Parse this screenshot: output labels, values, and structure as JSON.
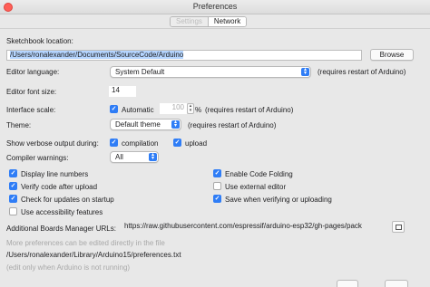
{
  "window": {
    "title": "Preferences"
  },
  "tabs": [
    {
      "label": "Settings",
      "active": false
    },
    {
      "label": "Network",
      "active": true
    }
  ],
  "sketchbook": {
    "label": "Sketchbook location:",
    "path": "/Users/ronalexander/Documents/SourceCode/Arduino",
    "browse_label": "Browse"
  },
  "editor_language": {
    "label": "Editor language:",
    "value": "System Default",
    "note": "(requires restart of Arduino)"
  },
  "editor_font_size": {
    "label": "Editor font size:",
    "value": "14"
  },
  "interface_scale": {
    "label": "Interface scale:",
    "automatic_label": "Automatic",
    "automatic_checked": true,
    "value": "100",
    "unit": "%",
    "note": "(requires restart of Arduino)"
  },
  "theme": {
    "label": "Theme:",
    "value": "Default theme",
    "note": "(requires restart of Arduino)"
  },
  "verbose": {
    "label": "Show verbose output during:",
    "compilation_label": "compilation",
    "compilation_checked": true,
    "upload_label": "upload",
    "upload_checked": true
  },
  "compiler_warnings": {
    "label": "Compiler warnings:",
    "value": "All"
  },
  "options_left": [
    {
      "label": "Display line numbers",
      "checked": true
    },
    {
      "label": "Verify code after upload",
      "checked": true
    },
    {
      "label": "Check for updates on startup",
      "checked": true
    },
    {
      "label": "Use accessibility features",
      "checked": false
    }
  ],
  "options_right": [
    {
      "label": "Enable Code Folding",
      "checked": true
    },
    {
      "label": "Use external editor",
      "checked": false
    },
    {
      "label": "Save when verifying or uploading",
      "checked": true
    }
  ],
  "boards_manager": {
    "label": "Additional Boards Manager URLs:",
    "value": "https://raw.githubusercontent.com/espressif/arduino-esp32/gh-pages/pack"
  },
  "footer": {
    "more_prefs": "More preferences can be edited directly in the file",
    "prefs_path": "/Users/ronalexander/Library/Arduino15/preferences.txt",
    "edit_note": "(edit only when Arduino is not running)"
  },
  "colors": {
    "accent": "#2f7df6",
    "selection": "#b5d5ff"
  }
}
